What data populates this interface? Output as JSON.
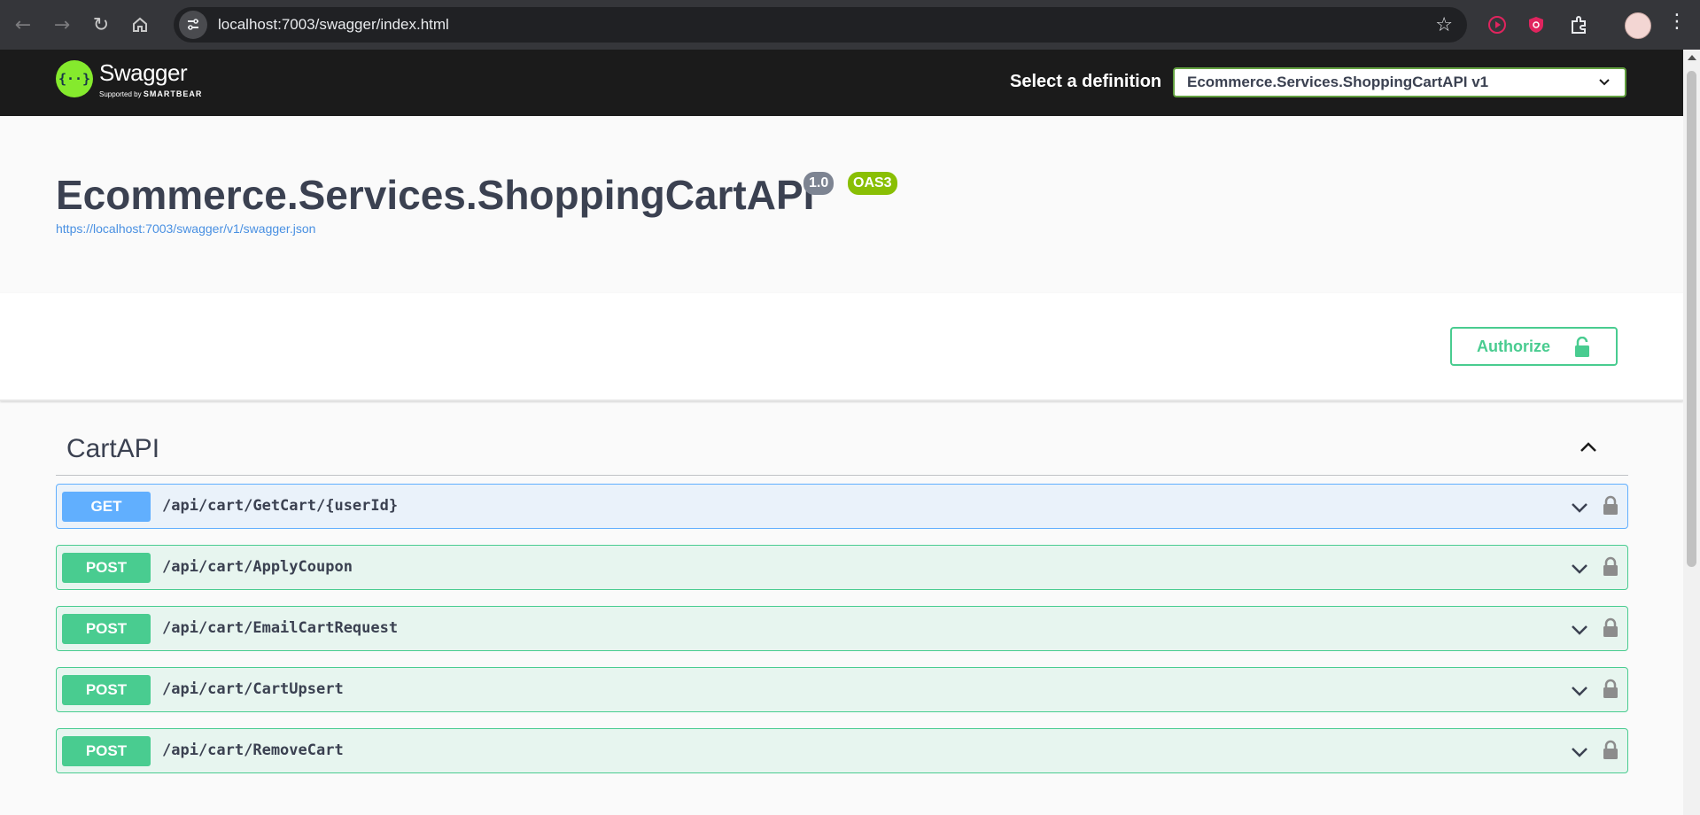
{
  "browser": {
    "url": "localhost:7003/swagger/index.html"
  },
  "topbar": {
    "logo_title": "Swagger",
    "logo_sub_prefix": "Supported by",
    "logo_sub_brand": "SMARTBEAR",
    "definition_label": "Select a definition",
    "definition_selected": "Ecommerce.Services.ShoppingCartAPI v1"
  },
  "info": {
    "title": "Ecommerce.Services.ShoppingCartAPI",
    "version": "1.0",
    "oas": "OAS3",
    "spec_url": "https://localhost:7003/swagger/v1/swagger.json"
  },
  "auth": {
    "authorize_label": "Authorize"
  },
  "tag": {
    "name": "CartAPI",
    "operations": [
      {
        "method": "GET",
        "path": "/api/cart/GetCart/{userId}"
      },
      {
        "method": "POST",
        "path": "/api/cart/ApplyCoupon"
      },
      {
        "method": "POST",
        "path": "/api/cart/EmailCartRequest"
      },
      {
        "method": "POST",
        "path": "/api/cart/CartUpsert"
      },
      {
        "method": "POST",
        "path": "/api/cart/RemoveCart"
      }
    ]
  },
  "colors": {
    "get": "#61affe",
    "post": "#49cc90",
    "topbar": "#1b1b1b",
    "accent_green": "#85ea2d"
  },
  "icons": [
    "back-icon",
    "forward-icon",
    "reload-icon",
    "home-icon",
    "site-info-icon",
    "star-icon",
    "extension-icon",
    "menu-icon",
    "lock-icon",
    "chevron-down-icon",
    "chevron-up-icon"
  ]
}
